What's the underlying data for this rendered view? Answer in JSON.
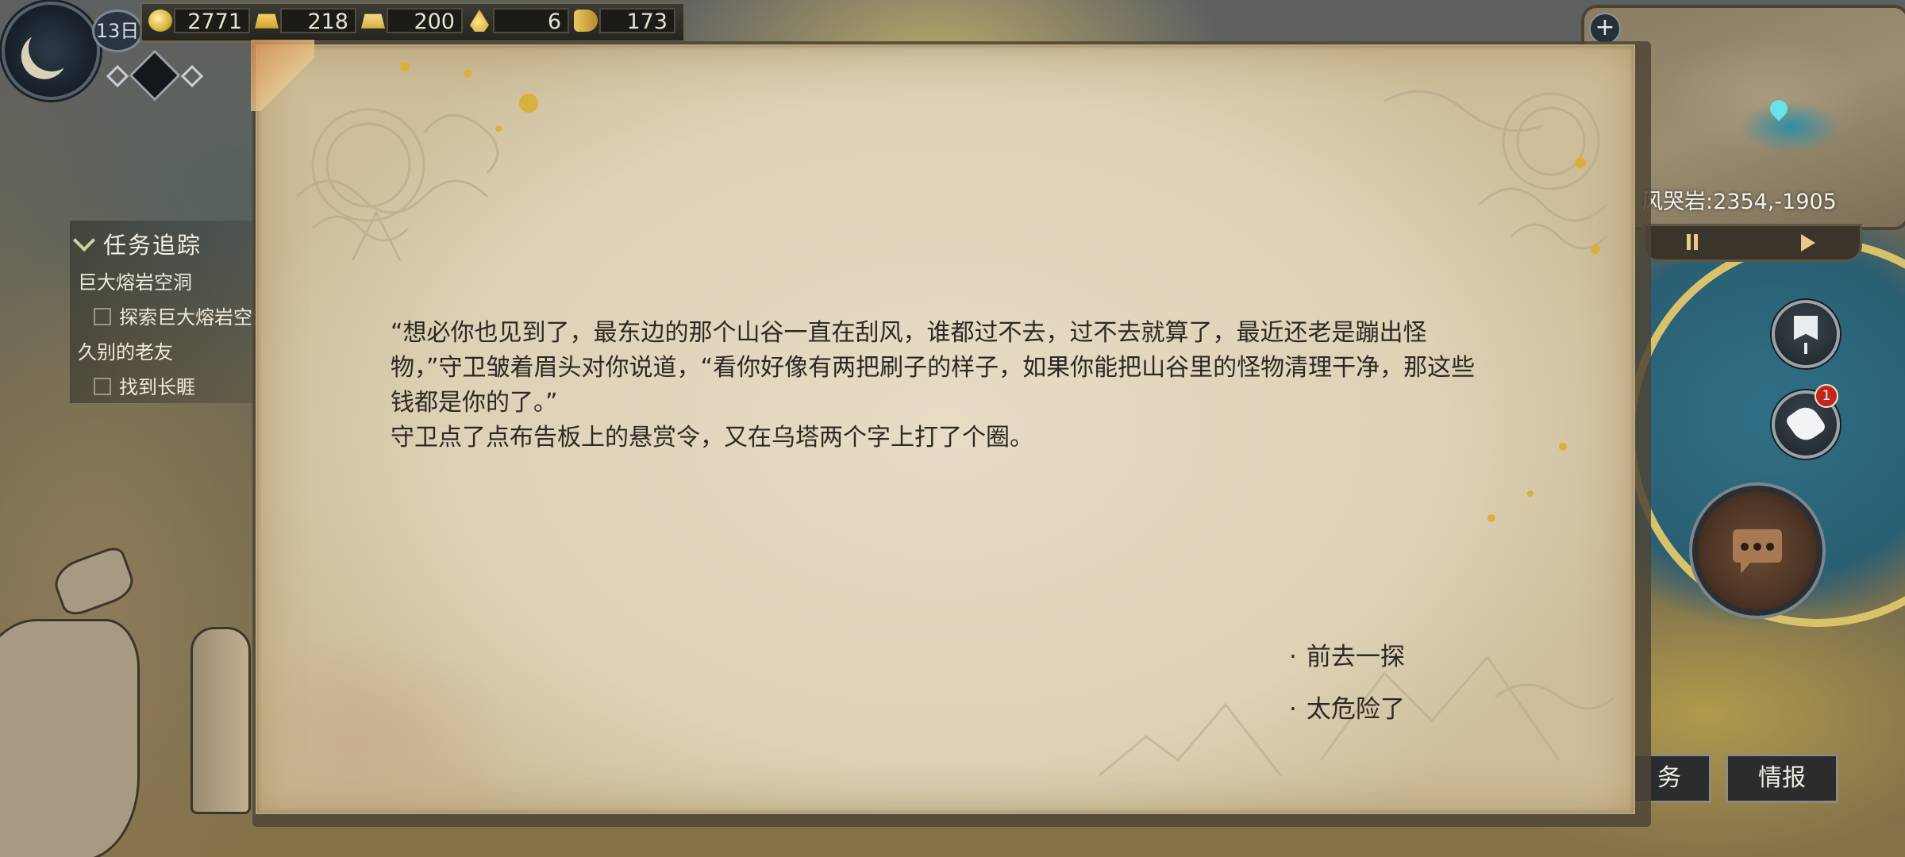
{
  "hud": {
    "day": "13日",
    "resources": [
      {
        "icon": "gold-coin-icon",
        "value": "2771"
      },
      {
        "icon": "gold-ingot-icon",
        "value": "218"
      },
      {
        "icon": "gold-bars-icon",
        "value": "200"
      },
      {
        "icon": "gold-drop-icon",
        "value": "6"
      },
      {
        "icon": "scroll-icon",
        "value": "173"
      }
    ]
  },
  "quest_tracker": {
    "title": "任务追踪",
    "quests": [
      {
        "name": "巨大熔岩空洞",
        "objective": "探索巨大熔岩空洞"
      },
      {
        "name": "久别的老友",
        "objective": "找到长睚"
      }
    ]
  },
  "minimap": {
    "coords": "风哭岩:2354,-1905"
  },
  "dialog": {
    "story": [
      "“想必你也见到了，最东边的那个山谷一直在刮风，谁都过不去，过不去就算了，最近还老是蹦出怪物，”守卫皱着眉头对你说道，“看你好像有两把刷子的样子，如果你能把山谷里的怪物清理干净，那这些钱都是你的了。”",
      "守卫点了点布告板上的悬赏令，又在乌塔两个字上打了个圈。"
    ],
    "choices": [
      "前去一探",
      "太危险了"
    ],
    "bullet": "·"
  },
  "right_panel": {
    "notification_count": "1",
    "quest_button_label": "务",
    "info_button_label": "情报"
  },
  "colors": {
    "parchment": "#ddd1b6",
    "gold_accent": "#d8b13c",
    "notification": "#c0271d",
    "water": "#2f6f86"
  }
}
